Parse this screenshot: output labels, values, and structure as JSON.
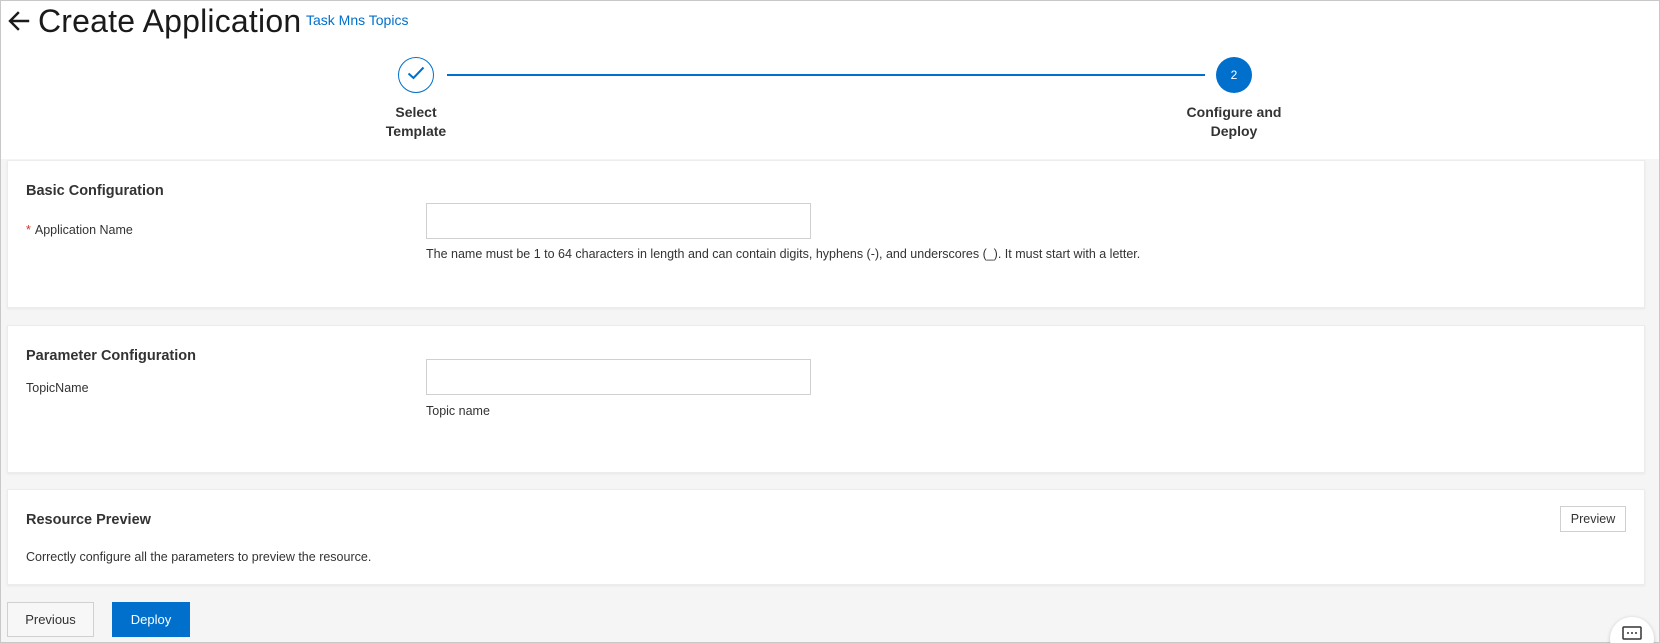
{
  "header": {
    "title": "Create Application",
    "template_link": "Task Mns Topics"
  },
  "stepper": {
    "steps": [
      {
        "label_line1": "Select",
        "label_line2": "Template",
        "state": "completed",
        "number": "1"
      },
      {
        "label_line1": "Configure and",
        "label_line2": "Deploy",
        "state": "active",
        "number": "2"
      }
    ]
  },
  "basic_config": {
    "title": "Basic Configuration",
    "required_mark": "*",
    "app_name_label": "Application Name",
    "app_name_value": "",
    "app_name_help": "The name must be 1 to 64 characters in length and can contain digits, hyphens (-), and underscores (_). It must start with a letter."
  },
  "param_config": {
    "title": "Parameter Configuration",
    "topic_label": "TopicName",
    "topic_value": "",
    "topic_help": "Topic name"
  },
  "resource_preview": {
    "title": "Resource Preview",
    "preview_button": "Preview",
    "description": "Correctly configure all the parameters to preview the resource."
  },
  "footer": {
    "previous_label": "Previous",
    "deploy_label": "Deploy"
  },
  "colors": {
    "accent": "#0070cc",
    "required": "#d93026"
  },
  "icons": {
    "back": "arrow-left-icon",
    "step_done": "checkmark-icon",
    "chat": "chat-icon"
  }
}
